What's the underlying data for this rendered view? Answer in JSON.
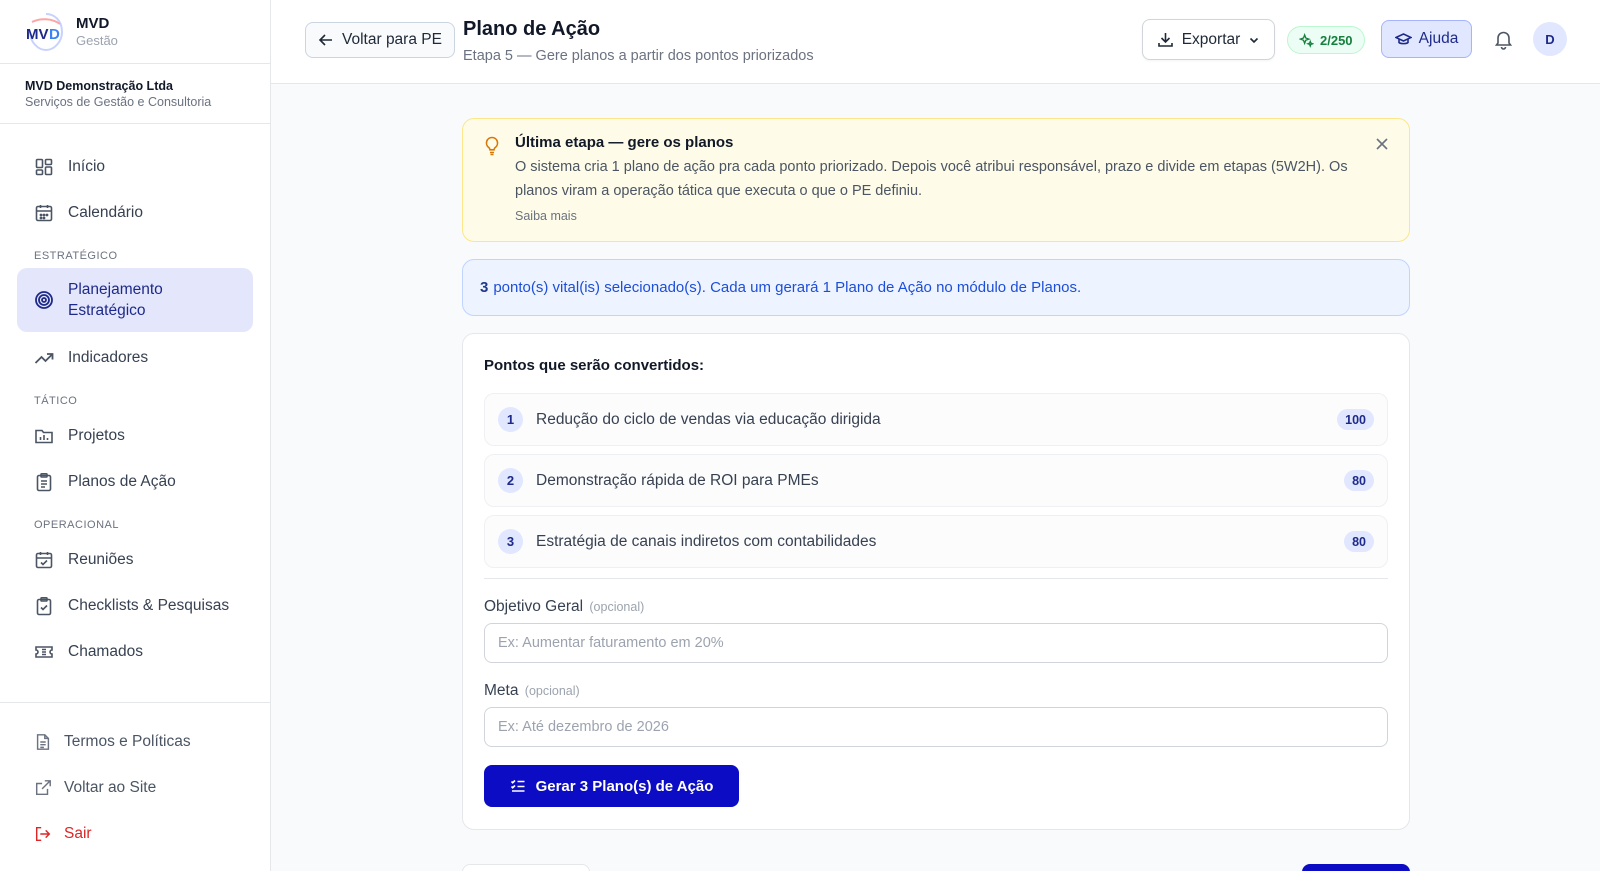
{
  "brand": {
    "name": "MVD",
    "sub": "Gestão"
  },
  "company": {
    "name": "MVD Demonstração Ltda",
    "desc": "Serviços de Gestão e Consultoria"
  },
  "nav": {
    "inicio": "Início",
    "calendario": "Calendário",
    "group_estrategico": "ESTRATÉGICO",
    "planejamento": "Planejamento Estratégico",
    "indicadores": "Indicadores",
    "group_tatico": "TÁTICO",
    "projetos": "Projetos",
    "planos": "Planos de Ação",
    "group_operacional": "OPERACIONAL",
    "reunioes": "Reuniões",
    "checklists": "Checklists & Pesquisas",
    "chamados": "Chamados"
  },
  "sidebar_bottom": {
    "termos": "Termos e Políticas",
    "voltar_site": "Voltar ao Site",
    "sair": "Sair"
  },
  "header": {
    "back_label": "Voltar para PE",
    "title": "Plano de Ação",
    "subtitle": "Etapa 5 — Gere planos a partir dos pontos priorizados",
    "export_label": "Exportar",
    "credits": "2/250",
    "help_label": "Ajuda",
    "avatar_initial": "D"
  },
  "tip": {
    "title": "Última etapa — gere os planos",
    "text": "O sistema cria 1 plano de ação pra cada ponto priorizado. Depois você atribui responsável, prazo e divide em etapas (5W2H). Os planos viram a operação tática que executa o que o PE definiu.",
    "link": "Saiba mais"
  },
  "info": {
    "count": "3",
    "text": "ponto(s) vital(is) selecionado(s). Cada um gerará 1 Plano de Ação no módulo de Planos."
  },
  "card": {
    "title": "Pontos que serão convertidos:",
    "points": [
      {
        "num": "1",
        "text": "Redução do ciclo de vendas via educação dirigida",
        "score": "100"
      },
      {
        "num": "2",
        "text": "Demonstração rápida de ROI para PMEs",
        "score": "80"
      },
      {
        "num": "3",
        "text": "Estratégia de canais indiretos com contabilidades",
        "score": "80"
      }
    ],
    "objetivo_label": "Objetivo Geral",
    "objetivo_opt": "(opcional)",
    "objetivo_placeholder": "Ex: Aumentar faturamento em 20%",
    "meta_label": "Meta",
    "meta_opt": "(opcional)",
    "meta_placeholder": "Ex: Até dezembro de 2026",
    "generate_label": "Gerar 3 Plano(s) de Ação"
  },
  "colors": {
    "accent": "#0c0cc4",
    "active_bg": "#e4e7fb",
    "tip_bg": "#fefce8",
    "info_bg": "#eef4ff",
    "logout": "#dc2626"
  }
}
